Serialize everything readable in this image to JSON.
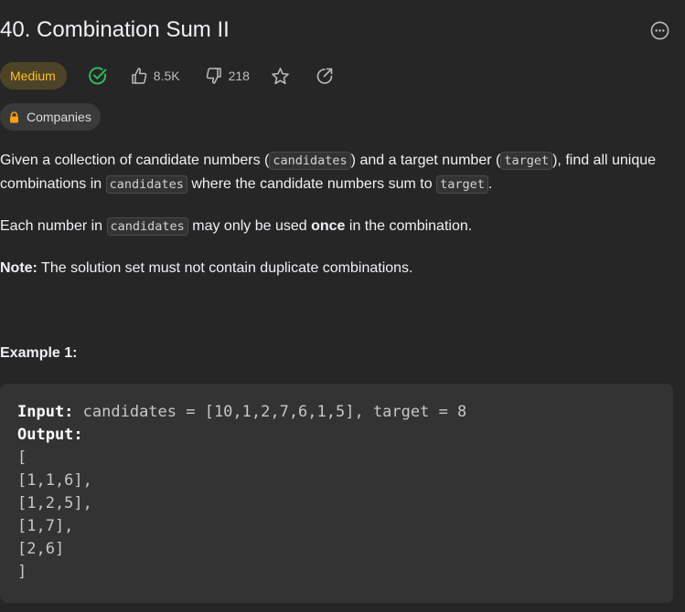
{
  "problem": {
    "title": "40. Combination Sum II",
    "difficulty": "Medium",
    "likes": "8.5K",
    "dislikes": "218",
    "companies_label": "Companies"
  },
  "description": {
    "p1": {
      "t1": "Given a collection of candidate numbers (",
      "c1": "candidates",
      "t2": ") and a target number (",
      "c2": "target",
      "t3": "), find all unique combinations in ",
      "c3": "candidates",
      "t4": " where the candidate numbers sum to ",
      "c4": "target",
      "t5": "."
    },
    "p2": {
      "t1": "Each number in ",
      "c1": "candidates",
      "t2": " may only be used ",
      "b1": "once",
      "t3": " in the combination."
    },
    "p3": {
      "b1": "Note:",
      "t1": " The solution set must not contain duplicate combinations."
    }
  },
  "example1": {
    "title": "Example 1:",
    "input_label": "Input:",
    "input_value": " candidates = [10,1,2,7,6,1,5], target = 8",
    "output_label": "Output:",
    "output_lines": [
      "[",
      "[1,1,6],",
      "[1,2,5],",
      "[1,7],",
      "[2,6]",
      "]"
    ]
  },
  "icons": {
    "more": "more-horizontal-icon",
    "solved": "check-circle-icon",
    "like": "thumbs-up-icon",
    "dislike": "thumbs-down-icon",
    "star": "star-icon",
    "share": "share-icon",
    "lock": "lock-icon"
  },
  "colors": {
    "background": "#262626",
    "difficulty_medium": "#ffc01e",
    "solved": "#2cbb5d",
    "lock": "#ffa116"
  }
}
